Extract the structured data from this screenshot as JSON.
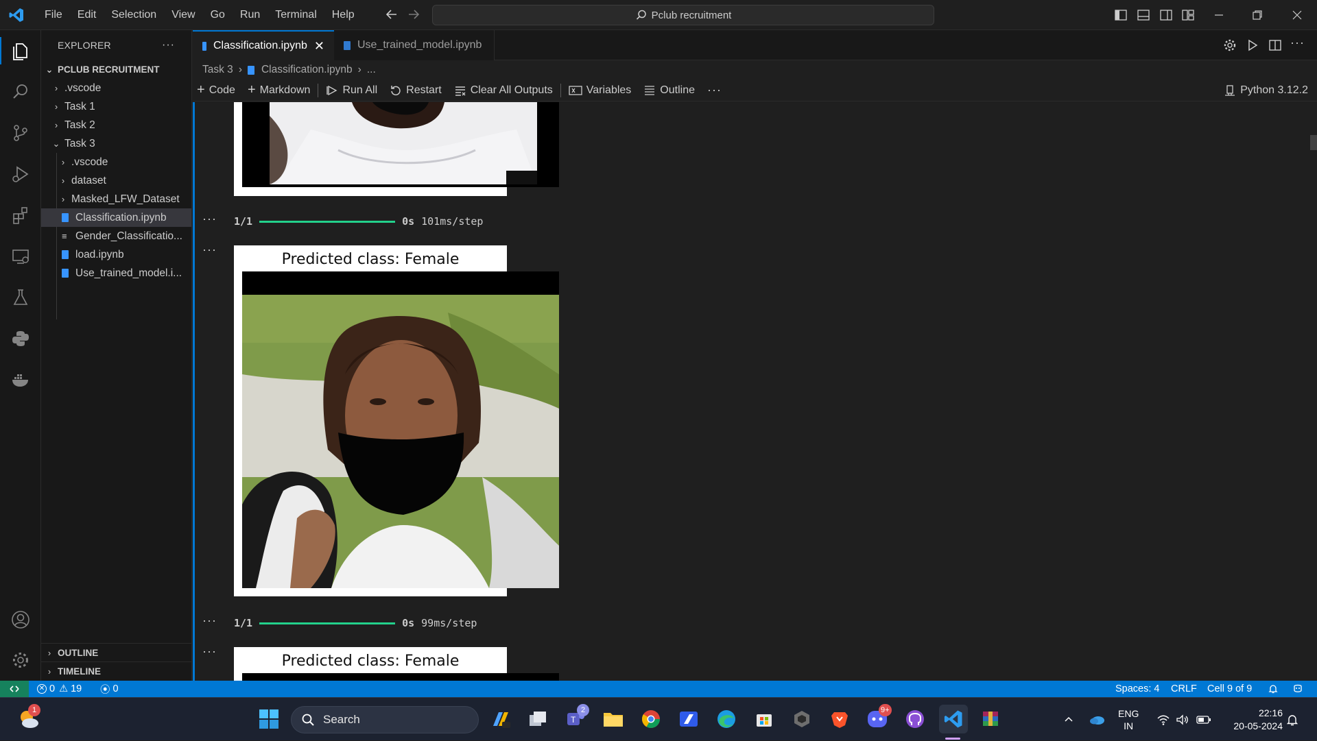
{
  "titlebar": {
    "menu": [
      "File",
      "Edit",
      "Selection",
      "View",
      "Go",
      "Run",
      "Terminal",
      "Help"
    ],
    "command_center": "Pclub recruitment"
  },
  "sidebar": {
    "title": "EXPLORER",
    "more": "···",
    "root": "PCLUB RECRUITMENT",
    "items": [
      {
        "label": ".vscode",
        "type": "folder",
        "expanded": false,
        "depth": 0
      },
      {
        "label": "Task 1",
        "type": "folder",
        "expanded": false,
        "depth": 0
      },
      {
        "label": "Task 2",
        "type": "folder",
        "expanded": false,
        "depth": 0
      },
      {
        "label": "Task 3",
        "type": "folder",
        "expanded": true,
        "depth": 0
      },
      {
        "label": ".vscode",
        "type": "folder",
        "expanded": false,
        "depth": 1
      },
      {
        "label": "dataset",
        "type": "folder",
        "expanded": false,
        "depth": 1
      },
      {
        "label": "Masked_LFW_Dataset",
        "type": "folder",
        "expanded": false,
        "depth": 1
      },
      {
        "label": "Classification.ipynb",
        "type": "notebook",
        "selected": true,
        "depth": 1
      },
      {
        "label": "Gender_Classificatio...",
        "type": "text",
        "depth": 1
      },
      {
        "label": "load.ipynb",
        "type": "notebook",
        "depth": 1
      },
      {
        "label": "Use_trained_model.i...",
        "type": "notebook",
        "depth": 1
      }
    ],
    "outline": "OUTLINE",
    "timeline": "TIMELINE"
  },
  "tabs": [
    {
      "label": "Classification.ipynb",
      "active": true
    },
    {
      "label": "Use_trained_model.ipynb",
      "active": false
    }
  ],
  "breadcrumb": [
    "Task 3",
    "Classification.ipynb",
    "..."
  ],
  "toolbar": {
    "code": "Code",
    "markdown": "Markdown",
    "run_all": "Run All",
    "restart": "Restart",
    "clear": "Clear All Outputs",
    "variables": "Variables",
    "outline": "Outline",
    "more": "···",
    "kernel": "Python 3.12.2"
  },
  "outputs": {
    "ellipsis": "···",
    "progress1": {
      "count": "1/1",
      "time": "0s",
      "rate": "101ms/step"
    },
    "figure1": {
      "title": "Predicted class: Female"
    },
    "progress2": {
      "count": "1/1",
      "time": "0s",
      "rate": "99ms/step"
    },
    "figure2": {
      "title": "Predicted class: Female"
    }
  },
  "statusbar": {
    "errors": "0",
    "warnings": "19",
    "ports": "0",
    "spaces": "Spaces: 4",
    "eol": "CRLF",
    "cell": "Cell 9 of 9"
  },
  "taskbar": {
    "search": "Search",
    "weather_badge": "1",
    "teams_badge": "2",
    "discord_badge": "9+",
    "lang": "ENG",
    "region": "IN",
    "time": "22:16",
    "date": "20-05-2024"
  },
  "colors": {
    "accent": "#0078d4",
    "progress": "#23d18b",
    "remote": "#16825d"
  }
}
